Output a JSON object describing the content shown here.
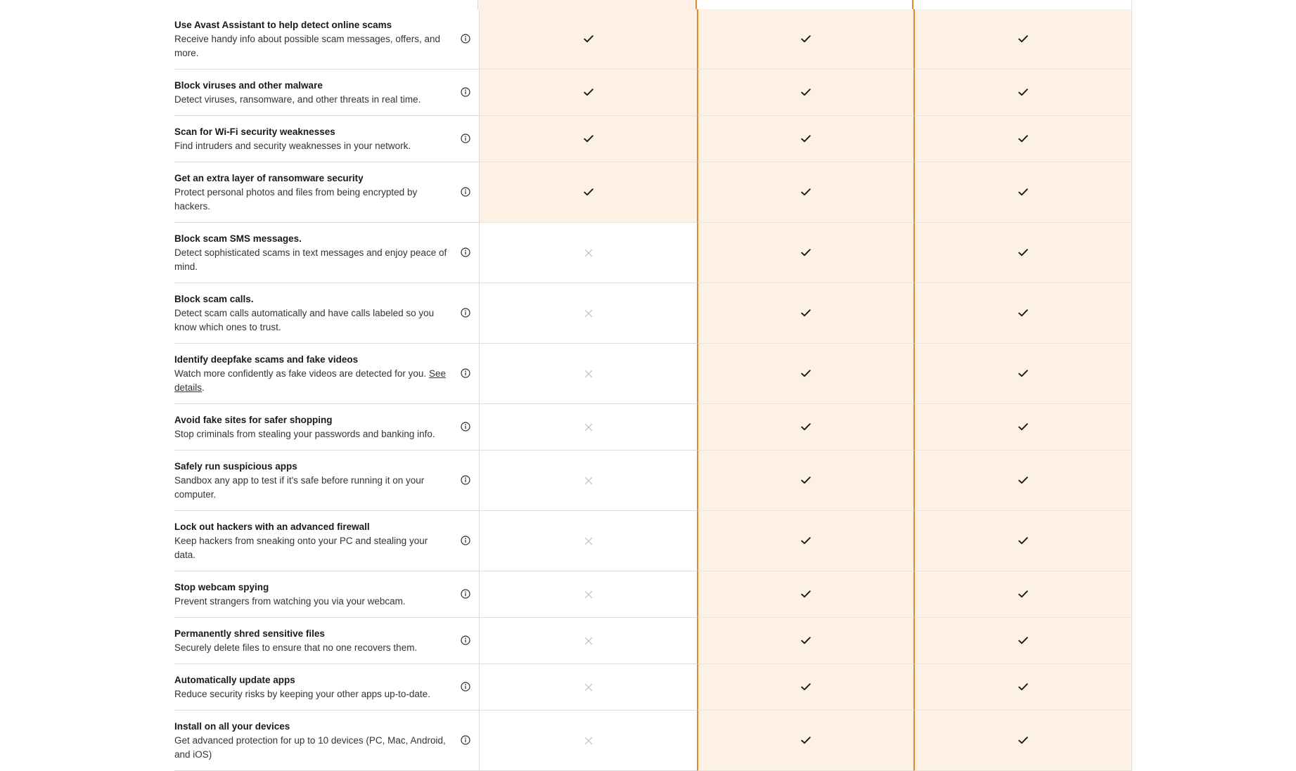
{
  "colors": {
    "accent_border": "#e08a25",
    "highlight_bg": "#fdf1e6",
    "check": "#1a1a1a",
    "cross": "#c8c8c8"
  },
  "icons": {
    "info": "info-circle-icon",
    "check": "check-icon",
    "cross": "cross-icon"
  },
  "features": [
    {
      "title": "Use Avast Assistant to help detect online scams",
      "desc": "Receive handy info about possible scam messages, offers, and more.",
      "plans": [
        true,
        true,
        true
      ]
    },
    {
      "title": "Block viruses and other malware",
      "desc": "Detect viruses, ransomware, and other threats in real time.",
      "plans": [
        true,
        true,
        true
      ]
    },
    {
      "title": "Scan for Wi-Fi security weaknesses",
      "desc": "Find intruders and security weaknesses in your network.",
      "plans": [
        true,
        true,
        true
      ]
    },
    {
      "title": "Get an extra layer of ransomware security",
      "desc": "Protect personal photos and files from being encrypted by hackers.",
      "plans": [
        true,
        true,
        true
      ]
    },
    {
      "title": "Block scam SMS messages.",
      "desc": "Detect sophisticated scams in text messages and enjoy peace of mind.",
      "plans": [
        false,
        true,
        true
      ]
    },
    {
      "title": "Block scam calls.",
      "desc": "Detect scam calls automatically and have calls labeled so you know which ones to trust.",
      "plans": [
        false,
        true,
        true
      ]
    },
    {
      "title": "Identify deepfake scams and fake videos",
      "desc": "Watch more confidently as fake videos are detected for you.",
      "link": "See details",
      "desc_after": ".",
      "plans": [
        false,
        true,
        true
      ]
    },
    {
      "title": "Avoid fake sites for safer shopping",
      "desc": "Stop criminals from stealing your passwords and banking info.",
      "plans": [
        false,
        true,
        true
      ]
    },
    {
      "title": "Safely run suspicious apps",
      "desc": "Sandbox any app to test if it's safe before running it on your computer.",
      "plans": [
        false,
        true,
        true
      ]
    },
    {
      "title": "Lock out hackers with an advanced firewall",
      "desc": "Keep hackers from sneaking onto your PC and stealing your data.",
      "plans": [
        false,
        true,
        true
      ]
    },
    {
      "title": "Stop webcam spying",
      "desc": "Prevent strangers from watching you via your webcam.",
      "plans": [
        false,
        true,
        true
      ]
    },
    {
      "title": "Permanently shred sensitive files",
      "desc": "Securely delete files to ensure that no one recovers them.",
      "plans": [
        false,
        true,
        true
      ]
    },
    {
      "title": "Automatically update apps",
      "desc": "Reduce security risks by keeping your other apps up-to-date.",
      "plans": [
        false,
        true,
        true
      ]
    },
    {
      "title": "Install on all your devices",
      "desc": "Get advanced protection for up to 10 devices (PC, Mac, Android, and iOS)",
      "plans": [
        false,
        true,
        true
      ]
    }
  ]
}
